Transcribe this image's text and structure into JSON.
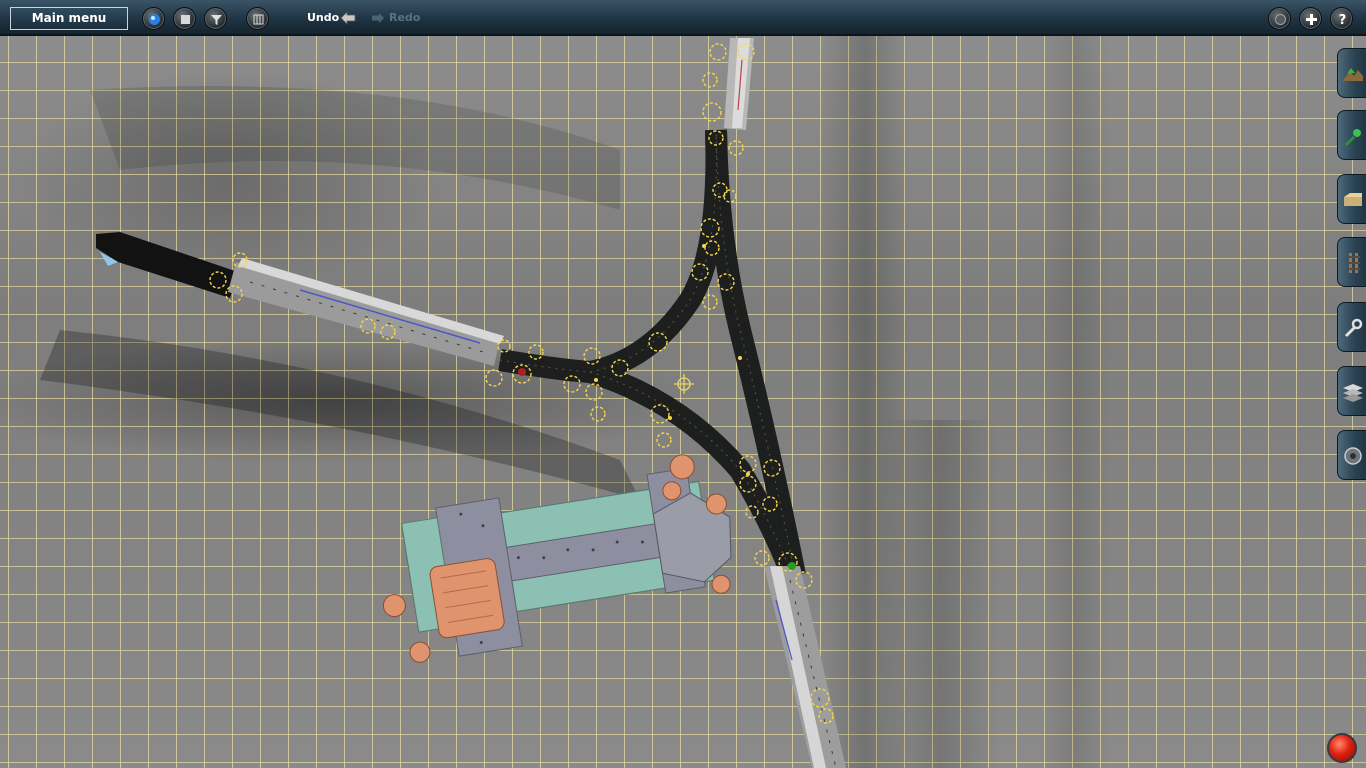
{
  "toolbar": {
    "main_menu_label": "Main menu",
    "undo_label": "Undo",
    "redo_label": "Redo"
  },
  "icons": {
    "left_tools": [
      "sphere-icon",
      "square-stop-icon",
      "filter-icon",
      "grid-icon"
    ],
    "right_tools": [
      "camera-icon",
      "add-icon",
      "help-icon"
    ],
    "side_tabs": [
      "terrain-icon",
      "paint-icon",
      "object-icon",
      "track-icon",
      "tools-icon",
      "layers-icon",
      "settings-icon"
    ]
  },
  "colors": {
    "toolbar_bg": "#1f3444",
    "grid_line": "#f2e7a8",
    "track_dark": "#1d1f1f",
    "platform": "#c8c8c8",
    "spline_marker": "#f5d64a",
    "building_roof": "#8bc0b2",
    "building_wall": "#8d8fa0",
    "building_copper": "#e0946e",
    "record": "#e02010"
  }
}
